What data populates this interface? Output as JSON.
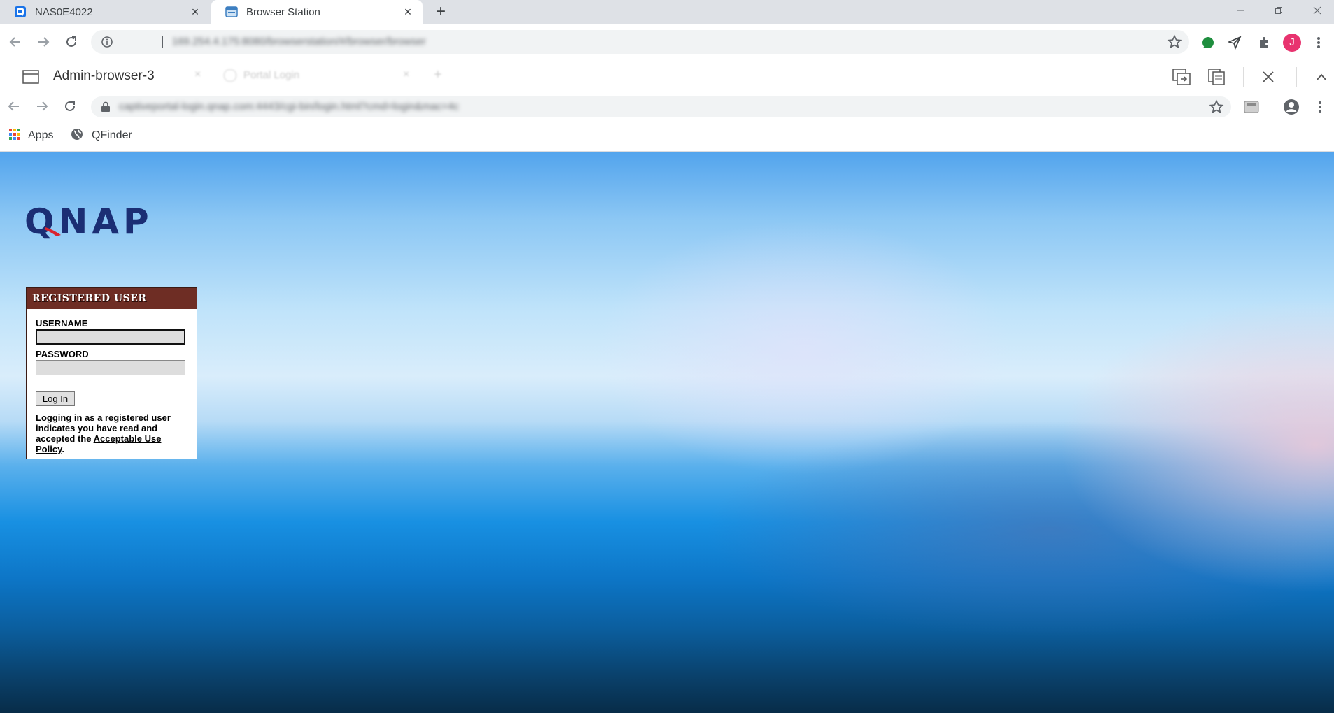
{
  "outer_browser": {
    "tabs": [
      {
        "label": "NAS0E4022",
        "active": false
      },
      {
        "label": "Browser Station",
        "active": true
      }
    ],
    "address": "169.254.4.175:8080/browserstation/#/browser/browser",
    "profile_initial": "J"
  },
  "browser_station": {
    "window_title": "Admin-browser-3",
    "ghost_tab_label": "Portal Login"
  },
  "inner_browser": {
    "address": "captiveportal-login.qnap.com:4443/cgi-bin/login.html?cmd=login&mac=4c",
    "bookmarks": [
      {
        "label": "Apps"
      },
      {
        "label": "QFinder"
      }
    ]
  },
  "login": {
    "logo_text": "QNAP",
    "header": "REGISTERED USER",
    "username_label": "USERNAME",
    "username_value": "",
    "password_label": "PASSWORD",
    "password_value": "",
    "login_button": "Log In",
    "policy_prefix": "Logging in as a registered user indicates you have read and accepted the ",
    "policy_link": "Acceptable Use Policy",
    "policy_suffix": "."
  },
  "colors": {
    "accent_blue": "#1a73e8",
    "login_header": "#6e2d24",
    "qnap_navy": "#1b2e74",
    "qnap_red": "#d9232e",
    "profile_pink": "#e8336f",
    "ext_green": "#1e8e3e"
  }
}
